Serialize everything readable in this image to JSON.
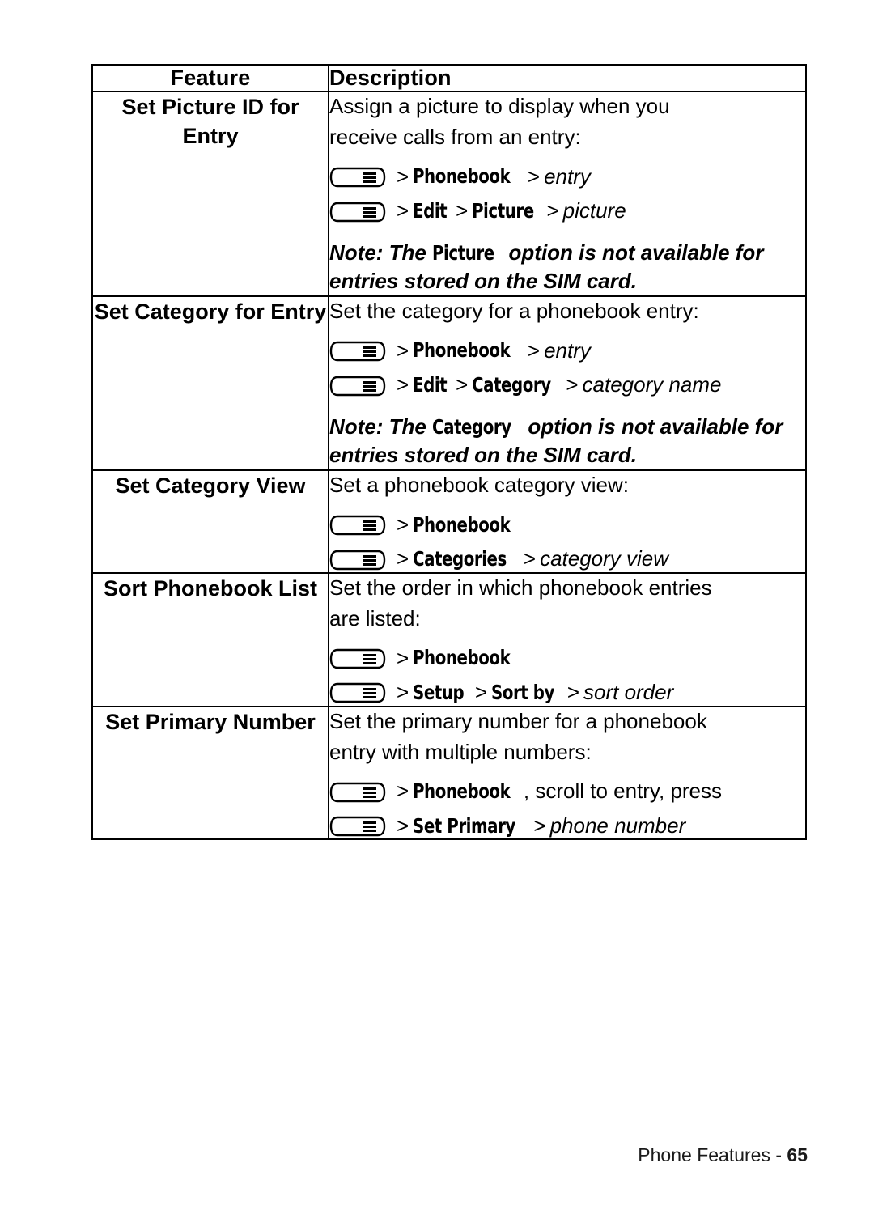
{
  "table": {
    "headers": [
      "Feature",
      "Description"
    ],
    "rows": [
      {
        "feature": "Set Picture ID for Entry",
        "desc_lines": [
          "Assign a picture to display when you",
          "receive calls from an entry:"
        ],
        "steps": [
          {
            "parts": [
              {
                "t": "sep",
                "v": ">"
              },
              {
                "t": "menu",
                "v": "Phonebook"
              },
              {
                "t": "sep",
                "v": ">"
              },
              {
                "t": "ital",
                "v": "entry"
              }
            ]
          },
          {
            "parts": [
              {
                "t": "sep",
                "v": ">"
              },
              {
                "t": "menu",
                "v": "Edit"
              },
              {
                "t": "sep",
                "v": ">"
              },
              {
                "t": "menu",
                "v": "Picture"
              },
              {
                "t": "sep",
                "v": ">"
              },
              {
                "t": "ital",
                "v": "picture"
              }
            ]
          }
        ],
        "note": {
          "parts": [
            {
              "t": "ital",
              "v": "Note:"
            },
            {
              "t": "ital",
              "v": "The"
            },
            {
              "t": "menu",
              "v": "Picture"
            },
            {
              "t": "ital",
              "v": "option is not available for entries stored on the SIM card."
            }
          ]
        }
      },
      {
        "feature": "Set Category for Entry",
        "desc_lines": [
          "Set the category for a phonebook entry:"
        ],
        "steps": [
          {
            "parts": [
              {
                "t": "sep",
                "v": ">"
              },
              {
                "t": "menu",
                "v": "Phonebook"
              },
              {
                "t": "sep",
                "v": ">"
              },
              {
                "t": "ital",
                "v": "entry"
              }
            ]
          },
          {
            "parts": [
              {
                "t": "sep",
                "v": ">"
              },
              {
                "t": "menu",
                "v": "Edit"
              },
              {
                "t": "sep",
                "v": ">"
              },
              {
                "t": "menu",
                "v": "Category"
              },
              {
                "t": "sep",
                "v": ">"
              },
              {
                "t": "ital",
                "v": "category name"
              }
            ]
          }
        ],
        "note": {
          "parts": [
            {
              "t": "ital",
              "v": "Note:"
            },
            {
              "t": "ital",
              "v": "The"
            },
            {
              "t": "menu",
              "v": "Category"
            },
            {
              "t": "ital",
              "v": "option is not available for entries stored on the SIM card."
            }
          ]
        }
      },
      {
        "feature": "Set Category View",
        "desc_lines": [
          "Set a phonebook category view:"
        ],
        "steps": [
          {
            "parts": [
              {
                "t": "sep",
                "v": ">"
              },
              {
                "t": "menu",
                "v": "Phonebook"
              }
            ]
          },
          {
            "parts": [
              {
                "t": "sep",
                "v": ">"
              },
              {
                "t": "menu",
                "v": "Categories"
              },
              {
                "t": "sep",
                "v": ">"
              },
              {
                "t": "ital",
                "v": "category view"
              }
            ]
          }
        ],
        "note": null
      },
      {
        "feature": "Sort Phonebook List",
        "desc_lines": [
          "Set the order in which phonebook entries",
          "are listed:"
        ],
        "steps": [
          {
            "parts": [
              {
                "t": "sep",
                "v": ">"
              },
              {
                "t": "menu",
                "v": "Phonebook"
              }
            ]
          },
          {
            "parts": [
              {
                "t": "sep",
                "v": ">"
              },
              {
                "t": "menu",
                "v": "Setup"
              },
              {
                "t": "sep",
                "v": ">"
              },
              {
                "t": "menu",
                "v": "Sort by"
              },
              {
                "t": "sep",
                "v": ">"
              },
              {
                "t": "ital",
                "v": "sort order"
              }
            ]
          }
        ],
        "note": null
      },
      {
        "feature": "Set Primary Number",
        "desc_lines": [
          "Set the primary number for a phonebook",
          "entry with multiple numbers:"
        ],
        "steps": [
          {
            "parts": [
              {
                "t": "sep",
                "v": ">"
              },
              {
                "t": "menu",
                "v": "Phonebook"
              },
              {
                "t": "plain",
                "v": ", scroll to entry, press"
              }
            ]
          },
          {
            "parts": [
              {
                "t": "sep",
                "v": ">"
              },
              {
                "t": "menu",
                "v": "Set Primary"
              },
              {
                "t": "sep",
                "v": ">"
              },
              {
                "t": "ital",
                "v": "phone number"
              }
            ]
          }
        ],
        "note": null
      }
    ]
  },
  "footer": {
    "label": "Phone Features -",
    "page": "65"
  },
  "icons": {
    "menu_key": "menu-key-icon"
  }
}
